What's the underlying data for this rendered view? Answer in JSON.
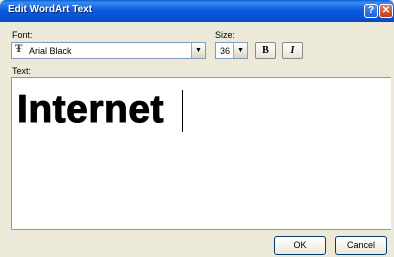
{
  "window": {
    "title": "Edit WordArt Text",
    "help_glyph": "?",
    "close_glyph": "✕"
  },
  "font": {
    "label": "Font:",
    "value": "Arial Black",
    "icon": "truetype-font-icon",
    "icon_glyph": "Ŧ"
  },
  "size": {
    "label": "Size:",
    "value": "36"
  },
  "format": {
    "bold_label": "B",
    "italic_label": "I"
  },
  "text": {
    "label": "Text:",
    "value": "Internet"
  },
  "buttons": {
    "ok": "OK",
    "cancel": "Cancel"
  },
  "colors": {
    "titlebar": "#0a5fd8",
    "dialog_bg": "#ece9d8",
    "close_button": "#c53a16"
  }
}
